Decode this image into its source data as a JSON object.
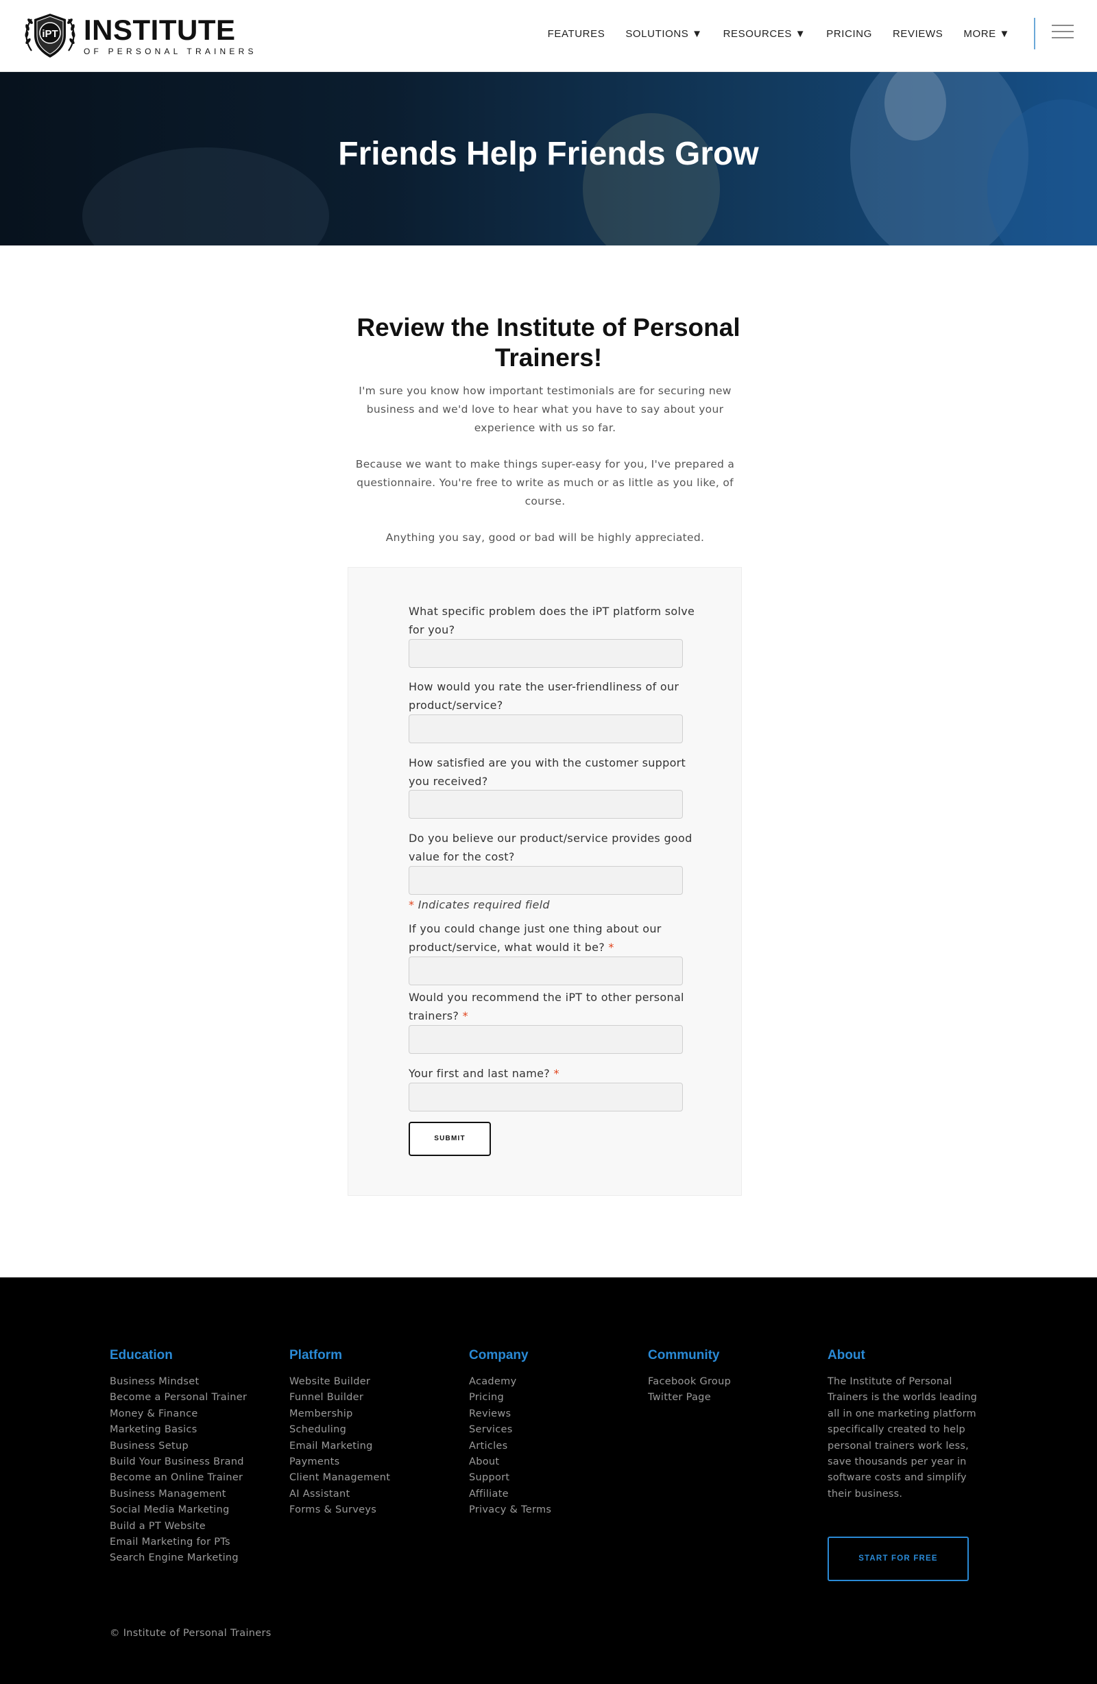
{
  "brand": {
    "badge_text": "iPT",
    "name": "INSTITUTE",
    "tagline": "OF PERSONAL TRAINERS"
  },
  "nav": {
    "items": [
      {
        "label": "FEATURES"
      },
      {
        "label": "SOLUTIONS ▼"
      },
      {
        "label": "RESOURCES ▼"
      },
      {
        "label": "PRICING"
      },
      {
        "label": "REVIEWS"
      },
      {
        "label": "MORE ▼"
      }
    ],
    "menu_icon": "hamburger-icon"
  },
  "hero": {
    "title": "Friends Help Friends Grow"
  },
  "main": {
    "title": "Review the Institute of Personal Trainers!",
    "paragraphs": [
      "I'm sure you know how important testimonials are for securing new business and we'd love to hear what you have to say about your experience with us so far.",
      "Because we want to make things super-easy for you, I've prepared a questionnaire. You're free to write as much or as little as you like, of course.",
      "Anything you say, good or bad will be highly appreciated."
    ]
  },
  "form": {
    "questions": [
      {
        "label": "What specific problem does the iPT platform solve for you?",
        "required": false,
        "value": ""
      },
      {
        "label": "How would you rate the user-friendliness of our product/service?",
        "required": false,
        "value": ""
      },
      {
        "label": "How satisfied are you with the customer support you received?",
        "required": false,
        "value": ""
      },
      {
        "label": "Do you believe our product/service provides good value for the cost?",
        "required": false,
        "value": ""
      },
      {
        "label": "If you could change just one thing about our product/service, what would it be?",
        "required": true,
        "value": ""
      },
      {
        "label": "Would you recommend the iPT to other personal trainers?",
        "required": true,
        "value": ""
      },
      {
        "label": "Your first and last name?",
        "required": true,
        "value": ""
      }
    ],
    "required_marker": "*",
    "required_note": "Indicates required field",
    "submit_label": "SUBMIT"
  },
  "footer": {
    "columns": [
      {
        "heading": "Education",
        "links": [
          "Business Mindset",
          "Become a Personal Trainer",
          "Money & Finance",
          "Marketing Basics",
          "Business Setup",
          "Build Your Business Brand",
          "Become an Online Trainer",
          "Business Management",
          "Social Media Marketing",
          "Build a PT Website",
          "Email Marketing for PTs",
          "Search Engine Marketing"
        ]
      },
      {
        "heading": "Platform",
        "links": [
          "Website Builder",
          "Funnel Builder",
          "Membership",
          "Scheduling",
          "Email Marketing",
          "Payments",
          "Client Management",
          "AI Assistant",
          "Forms & Surveys"
        ]
      },
      {
        "heading": "Company",
        "links": [
          "Academy",
          "Pricing",
          "Reviews",
          "Services",
          "Articles",
          "About",
          "Support",
          "Affiliate",
          "Privacy & Terms"
        ]
      },
      {
        "heading": "Community",
        "links": [
          "Facebook Group",
          "Twitter Page"
        ]
      }
    ],
    "about": {
      "heading": "About",
      "text": "The Institute of Personal Trainers is the worlds leading all in one marketing platform specifically created to help personal trainers work less, save thousands per year in software costs and simplify their business.",
      "cta_label": "START FOR FREE"
    },
    "copyright": "© Institute of Personal Trainers"
  },
  "colors": {
    "accent_blue": "#2a8ad6",
    "required_red": "#e0431b",
    "footer_bg": "#000000",
    "hero_dark": "#07121d",
    "hero_blue": "#165089"
  }
}
